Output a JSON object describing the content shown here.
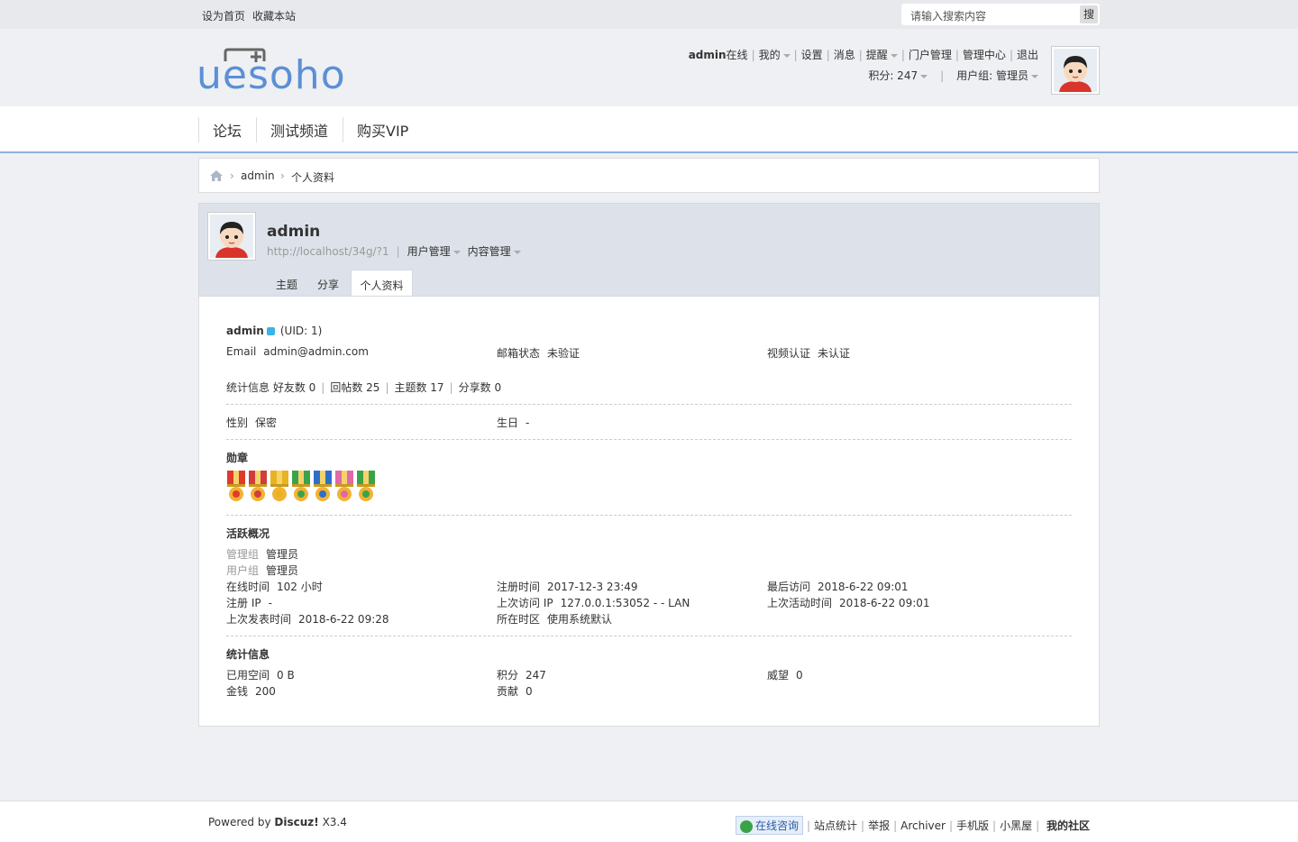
{
  "topbar": {
    "set_home": "设为首页",
    "bookmark": "收藏本站",
    "search_placeholder": "请输入搜索内容",
    "search_button": "搜"
  },
  "logo": {
    "text": "uesoho"
  },
  "usernav": {
    "username": "admin",
    "online": "在线",
    "items": [
      "我的",
      "设置",
      "消息",
      "提醒",
      "门户管理",
      "管理中心",
      "退出"
    ],
    "credits": "积分: 247",
    "usergroup": "用户组: 管理员"
  },
  "nav": {
    "items": [
      "论坛",
      "测试频道",
      "购买VIP"
    ]
  },
  "breadcrumb": {
    "items": [
      "admin",
      "个人资料"
    ],
    "separator": "›"
  },
  "profile": {
    "name": "admin",
    "url": "http://localhost/34g/?1",
    "user_manage": "用户管理",
    "content_manage": "内容管理",
    "tabs": [
      "主题",
      "分享",
      "个人资料"
    ]
  },
  "info": {
    "username": "admin",
    "uid": "(UID: 1)",
    "email_label": "Email",
    "email": "admin@admin.com",
    "mail_status_label": "邮箱状态",
    "mail_status": "未验证",
    "video_label": "视频认证",
    "video": "未认证",
    "stats_label": "统计信息",
    "friends": "好友数 0",
    "replies": "回帖数 25",
    "threads": "主题数 17",
    "shares": "分享数 0",
    "gender_label": "性别",
    "gender": "保密",
    "birthday_label": "生日",
    "birthday": "-"
  },
  "medals": {
    "title": "勋章",
    "colors": [
      "#e03a2a",
      "#d23c3c",
      "#e8b321",
      "#3aa34a",
      "#2f6fcc",
      "#e06aa8",
      "#3aa34a"
    ]
  },
  "activity": {
    "title": "活跃概况",
    "admin_group_label": "管理组",
    "admin_group": "管理员",
    "user_group_label": "用户组",
    "user_group": "管理员",
    "online_label": "在线时间",
    "online": "102 小时",
    "reg_time_label": "注册时间",
    "reg_time": "2017-12-3 23:49",
    "last_visit_label": "最后访问",
    "last_visit": "2018-6-22 09:01",
    "reg_ip_label": "注册 IP",
    "reg_ip": "-",
    "last_ip_label": "上次访问 IP",
    "last_ip": "127.0.0.1:53052 - - LAN",
    "last_active_label": "上次活动时间",
    "last_active": "2018-6-22 09:01",
    "last_post_label": "上次发表时间",
    "last_post": "2018-6-22 09:28",
    "timezone_label": "所在时区",
    "timezone": "使用系统默认"
  },
  "statistics": {
    "title": "统计信息",
    "space_label": "已用空间",
    "space": "0 B",
    "credits_label": "积分",
    "credits": "247",
    "prestige_label": "威望",
    "prestige": "0",
    "money_label": "金钱",
    "money": "200",
    "contrib_label": "贡献",
    "contrib": "0"
  },
  "footer": {
    "powered": "Powered by",
    "brand": "Discuz!",
    "version": "X3.4",
    "consult": "在线咨询",
    "links": [
      "站点统计",
      "举报",
      "Archiver",
      "手机版",
      "小黑屋"
    ],
    "community": "我的社区"
  }
}
